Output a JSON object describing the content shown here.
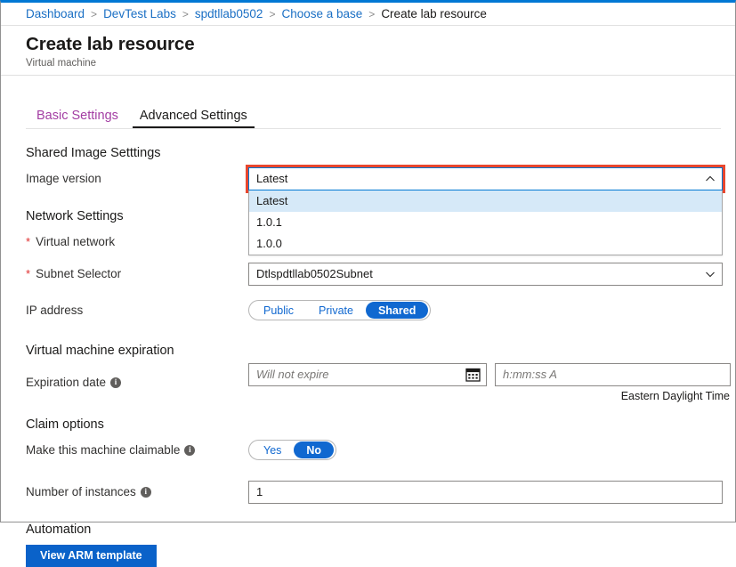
{
  "breadcrumb": {
    "items": [
      {
        "label": "Dashboard",
        "current": false
      },
      {
        "label": "DevTest Labs",
        "current": false
      },
      {
        "label": "spdtllab0502",
        "current": false
      },
      {
        "label": "Choose a base",
        "current": false
      },
      {
        "label": "Create lab resource",
        "current": true
      }
    ],
    "separator": ">"
  },
  "header": {
    "title": "Create lab resource",
    "subtitle": "Virtual machine"
  },
  "tabs": [
    {
      "label": "Basic Settings",
      "active": false
    },
    {
      "label": "Advanced Settings",
      "active": true
    }
  ],
  "sections": {
    "shared_image": {
      "heading": "Shared Image Setttings",
      "image_version": {
        "label": "Image version",
        "value": "Latest",
        "expanded": true,
        "options": [
          "Latest",
          "1.0.1",
          "1.0.0"
        ],
        "selected_option": "Latest",
        "highlight_color": "#e8472f",
        "chevron": "chevron-up"
      }
    },
    "network": {
      "heading": "Network Settings",
      "virtual_network": {
        "label": "Virtual network",
        "required": true,
        "required_marker": "*",
        "value": ""
      },
      "subnet_selector": {
        "label": "Subnet Selector",
        "required": true,
        "required_marker": "*",
        "value": "Dtlspdtllab0502Subnet",
        "chevron": "chevron-down"
      },
      "ip_address": {
        "label": "IP address",
        "options": [
          "Public",
          "Private",
          "Shared"
        ],
        "selected": "Shared"
      }
    },
    "expiration": {
      "heading": "Virtual machine expiration",
      "expiration_date": {
        "label": "Expiration date",
        "has_info": true,
        "info_glyph": "i",
        "value": "",
        "placeholder": "Will not expire",
        "icon": "calendar-icon"
      },
      "expiration_time": {
        "value": "",
        "placeholder": "h:mm:ss A"
      },
      "timezone_note": "Eastern Daylight Time"
    },
    "claim": {
      "heading": "Claim options",
      "claimable": {
        "label": "Make this machine claimable",
        "has_info": true,
        "info_glyph": "i",
        "options": [
          "Yes",
          "No"
        ],
        "selected": "No"
      },
      "instances": {
        "label": "Number of instances",
        "has_info": true,
        "info_glyph": "i",
        "value": "1"
      }
    },
    "automation": {
      "heading": "Automation",
      "view_arm_button": "View ARM template"
    }
  },
  "theme": {
    "accent_blue": "#0078d4",
    "toggle_blue": "#1068d0",
    "button_blue": "#0a62c9",
    "link_blue": "#1a6fc4",
    "visited_tab_purple": "#a33ea3",
    "required_red": "#e02f2f",
    "highlight_red": "#e8472f"
  }
}
